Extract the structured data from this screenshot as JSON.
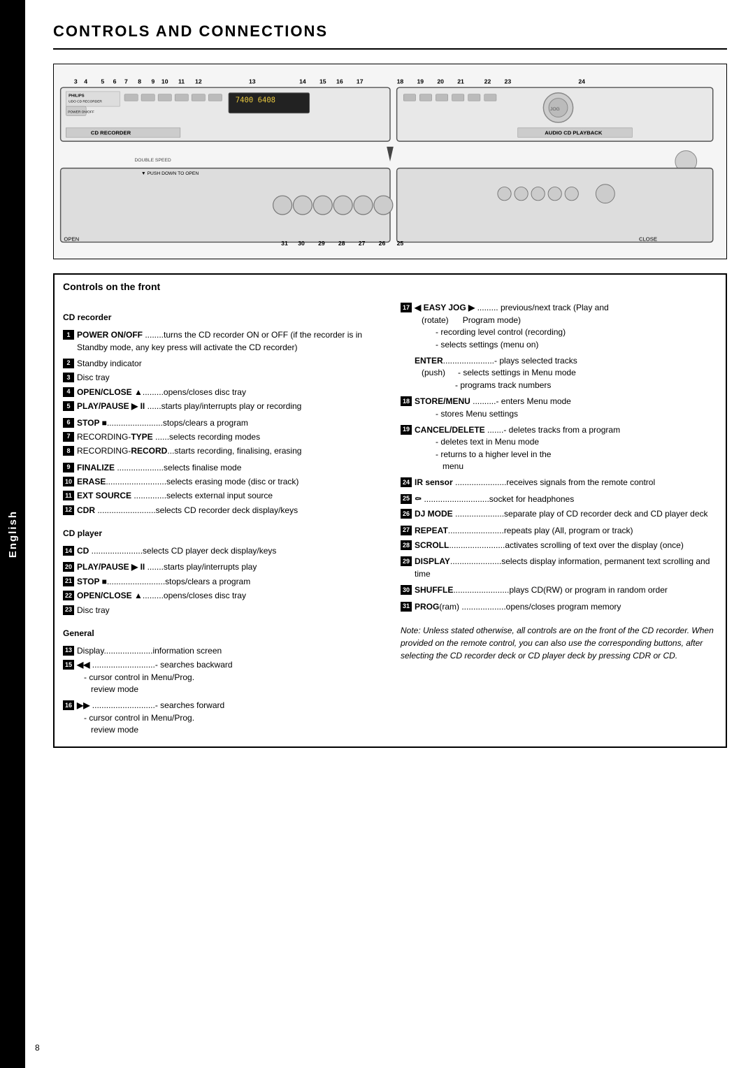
{
  "page": {
    "title": "CONTROLS AND CONNECTIONS",
    "sidebar_label": "English",
    "page_number": "8"
  },
  "diagram": {
    "top_labels": [
      "3",
      "4",
      "5",
      "6",
      "7",
      "8",
      "9",
      "10",
      "11",
      "12",
      "13",
      "14",
      "15",
      "16",
      "17",
      "18",
      "19",
      "20",
      "21",
      "22",
      "23",
      "24",
      "25",
      "26",
      "27",
      "28",
      "29",
      "30",
      "31"
    ]
  },
  "controls_section": {
    "title": "Controls on the front"
  },
  "cd_recorder": {
    "heading": "CD recorder",
    "items": [
      {
        "num": "1",
        "name": "POWER ON/OFF",
        "dots": " ........",
        "desc": "turns the CD recorder ON or OFF (if the recorder is in Standby mode, any key press will activate the CD recorder)"
      },
      {
        "num": "2",
        "name": "",
        "desc": "Standby indicator"
      },
      {
        "num": "3",
        "name": "",
        "desc": "Disc tray"
      },
      {
        "num": "4",
        "name": "OPEN/CLOSE ▲",
        "dots": "..........",
        "desc": "opens/closes disc tray"
      },
      {
        "num": "5",
        "name": "PLAY/PAUSE ▶ II",
        "dots": " ......",
        "desc": "starts play/interrupts play or recording"
      },
      {
        "num": "6",
        "name": "STOP ■",
        "dots": "........................",
        "desc": "stops/clears a program"
      },
      {
        "num": "7",
        "name": "RECORDING-TYPE",
        "dots": " ......",
        "desc": "selects recording modes"
      },
      {
        "num": "8",
        "name": "RECORDING-RECORD",
        "dots": "...",
        "desc": "starts recording, finalising, erasing"
      },
      {
        "num": "9",
        "name": "FINALIZE",
        "dots": " ....................",
        "desc": "selects finalise mode"
      },
      {
        "num": "10",
        "name": "ERASE",
        "dots": "..........................",
        "desc": "selects erasing mode (disc or track)"
      },
      {
        "num": "11",
        "name": "EXT SOURCE",
        "dots": " ..............",
        "desc": "selects external input source"
      },
      {
        "num": "12",
        "name": "CDR",
        "dots": "  .........................",
        "desc": "selects CD recorder deck display/keys"
      }
    ]
  },
  "cd_player": {
    "heading": "CD player",
    "items": [
      {
        "num": "14",
        "name": "CD",
        "dots": "  ......................",
        "desc": "selects CD player deck display/keys"
      },
      {
        "num": "20",
        "name": "PLAY/PAUSE ▶ II",
        "dots": " .......",
        "desc": "starts play/interrupts play"
      },
      {
        "num": "21",
        "name": "STOP ■",
        "dots": ".........................",
        "desc": "stops/clears a program"
      },
      {
        "num": "22",
        "name": "OPEN/CLOSE ▲",
        "dots": "..........",
        "desc": "opens/closes disc tray"
      },
      {
        "num": "23",
        "name": "",
        "desc": "Disc tray"
      }
    ]
  },
  "general": {
    "heading": "General",
    "items": [
      {
        "num": "13",
        "name": "Display",
        "dots": ".....................",
        "desc": "information screen"
      },
      {
        "num": "15",
        "name": "◀◀",
        "dots": " ...........................",
        "desc": "- searches backward",
        "sub": "- cursor control in Menu/Prog. review mode"
      },
      {
        "num": "16",
        "name": "▶▶",
        "dots": " ...........................",
        "desc": "- searches forward",
        "sub": "- cursor control in Menu/Prog. review mode"
      }
    ]
  },
  "right_col": {
    "items": [
      {
        "num": "17",
        "name": "◀ EASY JOG ▶",
        "dots": " .........",
        "desc": "previous/next track (Play and Program mode)",
        "subs": [
          "recording level control (recording)",
          "selects settings (menu on)"
        ]
      },
      {
        "name": "ENTER",
        "dots": "......................",
        "desc": "plays selected tracks",
        "sub_label": "(push)",
        "subs": [
          "selects settings in Menu mode",
          "programs track numbers"
        ]
      },
      {
        "num": "18",
        "name": "STORE/MENU",
        "dots": " ..........",
        "desc": "enters Menu mode",
        "subs": [
          "stores Menu settings"
        ]
      },
      {
        "num": "19",
        "name": "CANCEL/DELETE",
        "dots": " .......",
        "desc": "deletes tracks from a program",
        "subs": [
          "deletes text in Menu mode",
          "returns to a higher level in the menu"
        ]
      },
      {
        "num": "24",
        "name": "IR sensor",
        "dots": " ......................",
        "desc": "receives signals from the remote control"
      },
      {
        "num": "25",
        "name": "🎧",
        "dots": " ............................",
        "desc": "socket for headphones"
      },
      {
        "num": "26",
        "name": "DJ MODE",
        "dots": " ......................",
        "desc": "separate play of CD recorder deck and CD player deck"
      },
      {
        "num": "27",
        "name": "REPEAT",
        "dots": "........................",
        "desc": "repeats play (All, program or track)"
      },
      {
        "num": "28",
        "name": "SCROLL",
        "dots": "........................",
        "desc": "activates scrolling of text over the display (once)"
      },
      {
        "num": "29",
        "name": "DISPLAY",
        "dots": "......................",
        "desc": "selects display information, permanent text scrolling and time"
      },
      {
        "num": "30",
        "name": "SHUFFLE",
        "dots": "........................",
        "desc": "plays CD(RW) or program in random order"
      },
      {
        "num": "31",
        "name": "PROG(ram)",
        "dots": " ...................",
        "desc": "opens/closes program memory"
      }
    ],
    "note": "Note: Unless stated otherwise, all controls are on the front of the CD recorder. When provided on the remote control, you can also use the corresponding buttons, after selecting the CD recorder deck or CD player deck by pressing CDR or CD."
  }
}
